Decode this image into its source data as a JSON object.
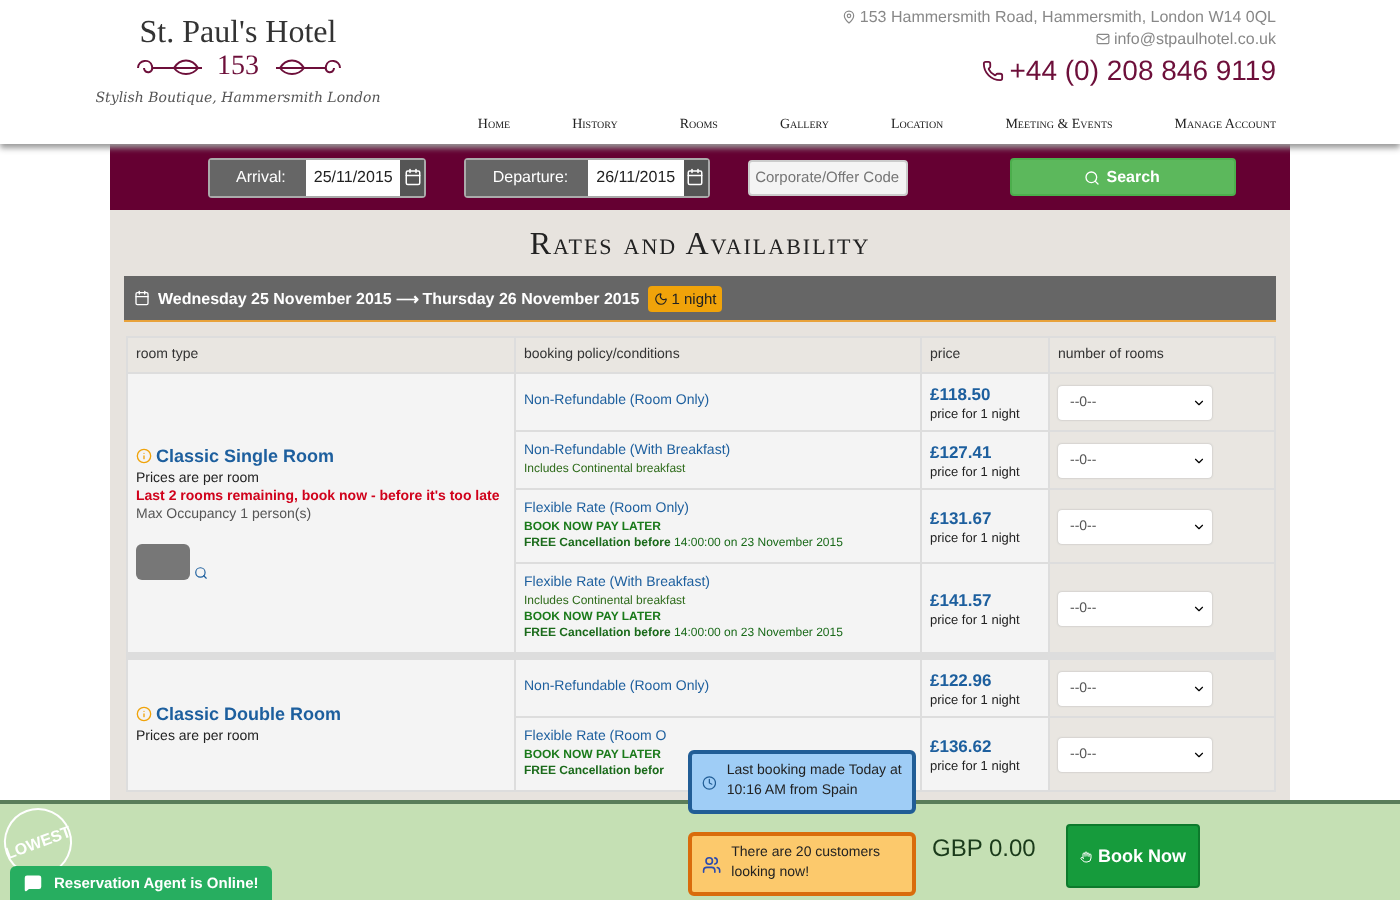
{
  "hotel": {
    "name": "St. Paul's Hotel",
    "number": "153",
    "tagline": "Stylish Boutique, Hammersmith London"
  },
  "contact": {
    "address": "153 Hammersmith Road, Hammersmith, London W14 0QL",
    "email": "info@stpaulhotel.co.uk",
    "phone": "+44 (0) 208 846 9119"
  },
  "nav": [
    "Home",
    "History",
    "Rooms",
    "Gallery",
    "Location",
    "Meeting & Events",
    "Manage Account"
  ],
  "search": {
    "arrival_label": "Arrival:",
    "arrival": "25/11/2015",
    "departure_label": "Departure:",
    "departure": "26/11/2015",
    "code_placeholder": "Corporate/Offer Code",
    "button": "Search"
  },
  "title": "Rates and Availability",
  "stay": {
    "dates": "Wednesday 25 November 2015 ⟶ Thursday 26 November 2015",
    "nights": "1 night"
  },
  "table": {
    "columns": [
      "room type",
      "booking policy/conditions",
      "price",
      "number of rooms"
    ],
    "rooms": [
      {
        "name": "Classic Single Room",
        "notes": [
          {
            "kind": "plain",
            "text": "Prices are per room"
          },
          {
            "kind": "warning",
            "text": "Last 2 rooms remaining, book now - before it's too late"
          },
          {
            "kind": "muted",
            "text": "Max Occupancy 1 person(s)"
          }
        ],
        "photo": true,
        "rates": [
          {
            "name": "Non-Refundable (Room Only)",
            "price": "£118.50",
            "price_note": "price for 1 night",
            "rooms": "--0--"
          },
          {
            "name": "Non-Refundable (With Breakfast)",
            "details": [
              {
                "kind": "included",
                "text": "Includes Continental breakfast"
              }
            ],
            "price": "£127.41",
            "price_note": "price for 1 night",
            "rooms": "--0--"
          },
          {
            "name": "Flexible Rate (Room Only)",
            "details": [
              {
                "kind": "pay_later",
                "text": "BOOK NOW PAY LATER"
              },
              {
                "kind": "cancellation",
                "text": "**FREE Cancellation before** 14:00:00 on 23 November 2015"
              }
            ],
            "price": "£131.67",
            "price_note": "price for 1 night",
            "rooms": "--0--"
          },
          {
            "name": "Flexible Rate (With Breakfast)",
            "details": [
              {
                "kind": "included",
                "text": "Includes Continental breakfast"
              },
              {
                "kind": "pay_later",
                "text": "BOOK NOW PAY LATER"
              },
              {
                "kind": "cancellation",
                "text": "**FREE Cancellation before** 14:00:00 on 23 November 2015"
              }
            ],
            "price": "£141.57",
            "price_note": "price for 1 night",
            "rooms": "--0--"
          }
        ]
      },
      {
        "name": "Classic Double Room",
        "notes": [
          {
            "kind": "plain",
            "text": "Prices are per room"
          }
        ],
        "rates": [
          {
            "name": "Non-Refundable (Room Only)",
            "price": "£122.96",
            "price_note": "price for 1 night",
            "rooms": "--0--"
          },
          {
            "name": "Flexible Rate (Room O",
            "details": [
              {
                "kind": "pay_later",
                "text": "BOOK NOW PAY LATER"
              },
              {
                "kind": "cancellation",
                "text": "**FREE Cancellation befor**"
              }
            ],
            "price": "£136.62",
            "price_note": "price for 1 night",
            "rooms": "--0--"
          }
        ]
      }
    ]
  },
  "footer": {
    "badge": "LOWEST",
    "agent": "Reservation Agent is Online!",
    "total": "GBP 0.00",
    "book": "Book Now",
    "popups": [
      {
        "kind": "recent",
        "text": "Last booking made Today at 10:16 AM from Spain"
      },
      {
        "kind": "viewers",
        "text": "There are 20 customers looking now!"
      }
    ]
  }
}
